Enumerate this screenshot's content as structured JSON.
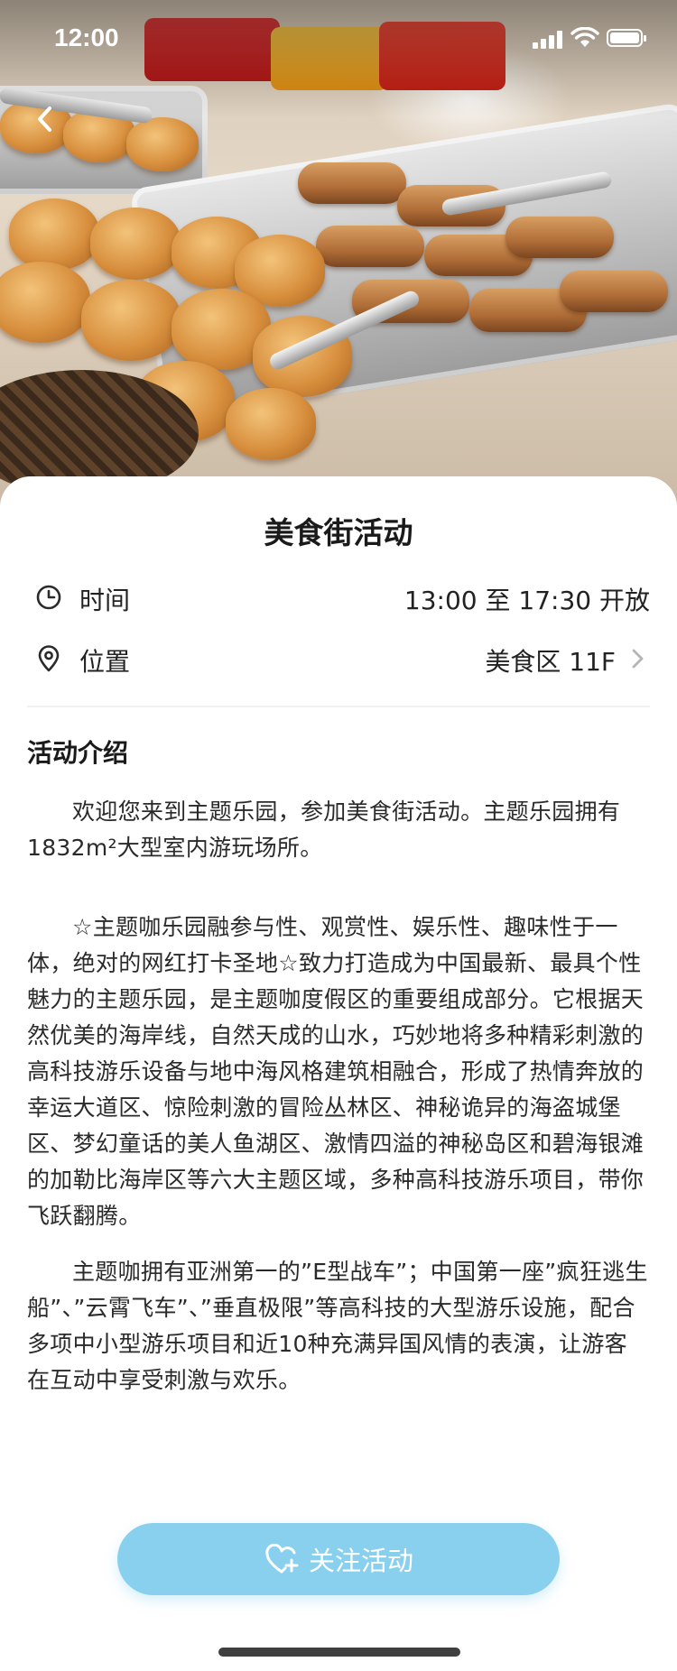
{
  "status_bar": {
    "time": "12:00"
  },
  "event": {
    "title": "美食街活动",
    "time_label": "时间",
    "time_value": "13:00 至 17:30 开放",
    "location_label": "位置",
    "location_value": "美食区 11F"
  },
  "intro": {
    "heading": "活动介绍",
    "paragraphs": [
      "欢迎您来到主题乐园，参加美食街活动。主题乐园拥有1832m²大型室内游玩场所。",
      "☆主题咖乐园融参与性、观赏性、娱乐性、趣味性于一体，绝对的网红打卡圣地☆致力打造成为中国最新、最具个性魅力的主题乐园，是主题咖度假区的重要组成部分。它根据天然优美的海岸线，自然天成的山水，巧妙地将多种精彩刺激的高科技游乐设备与地中海风格建筑相融合，形成了热情奔放的幸运大道区、惊险刺激的冒险丛林区、神秘诡异的海盗城堡区、梦幻童话的美人鱼湖区、激情四溢的神秘岛区和碧海银滩的加勒比海岸区等六大主题区域，多种高科技游乐项目，带你飞跃翻腾。",
      "主题咖拥有亚洲第一的”E型战车”；中国第一座”疯狂逃生船”、”云霄飞车”、”垂直极限”等高科技的大型游乐设施，配合多项中小型游乐项目和近10种充满异国风情的表演，让游客在互动中享受刺激与欢乐。"
    ]
  },
  "follow_button": {
    "label": "关注活动"
  },
  "icons": {
    "back": "back-arrow-icon",
    "time": "clock-icon",
    "location": "location-pin-icon",
    "chevron": "chevron-right-icon",
    "follow": "heart-plus-icon"
  },
  "colors": {
    "button_bg": "#88d0ee",
    "text_primary": "#1e1e1e",
    "chevron": "#b5b5b5"
  }
}
